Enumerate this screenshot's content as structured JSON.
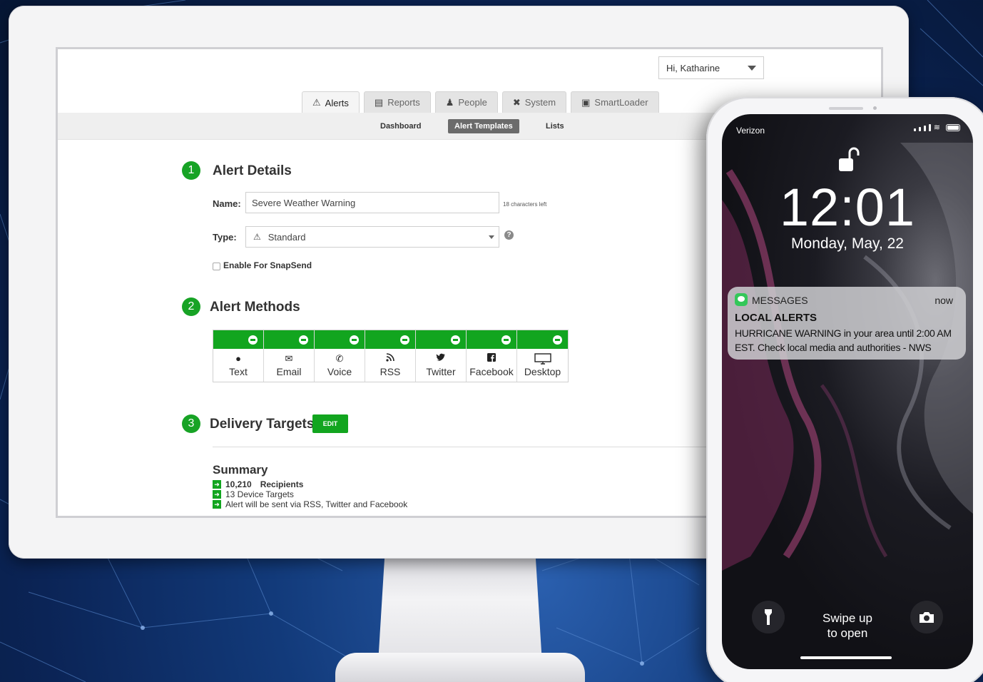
{
  "header": {
    "user_greeting": "Hi, Katharine"
  },
  "tabs": [
    {
      "label": "Alerts",
      "icon": "alert-triangle-icon",
      "active": true
    },
    {
      "label": "Reports",
      "icon": "reports-icon",
      "active": false
    },
    {
      "label": "People",
      "icon": "people-icon",
      "active": false
    },
    {
      "label": "System",
      "icon": "tools-icon",
      "active": false
    },
    {
      "label": "SmartLoader",
      "icon": "folder-upload-icon",
      "active": false
    }
  ],
  "subnav": [
    {
      "label": "Dashboard",
      "active": false
    },
    {
      "label": "Alert Templates",
      "active": true
    },
    {
      "label": "Lists",
      "active": false
    }
  ],
  "section1": {
    "number": "1",
    "title": "Alert Details",
    "name_label": "Name:",
    "name_value": "Severe Weather Warning",
    "chars_left": "18 characters left",
    "type_label": "Type:",
    "type_value": "Standard",
    "snapsend_label": "Enable For SnapSend"
  },
  "section2": {
    "number": "2",
    "title": "Alert Methods",
    "methods": [
      {
        "label": "Text",
        "icon": "speech-bubble-icon"
      },
      {
        "label": "Email",
        "icon": "envelope-icon"
      },
      {
        "label": "Voice",
        "icon": "phone-icon"
      },
      {
        "label": "RSS",
        "icon": "rss-icon"
      },
      {
        "label": "Twitter",
        "icon": "twitter-icon"
      },
      {
        "label": "Facebook",
        "icon": "facebook-icon"
      },
      {
        "label": "Desktop",
        "icon": "desktop-icon"
      }
    ]
  },
  "section3": {
    "number": "3",
    "title": "Delivery Targets",
    "edit_label": "EDIT"
  },
  "summary": {
    "title": "Summary",
    "recipients_count": "10,210",
    "recipients_label": "Recipients",
    "device_targets": "13 Device Targets",
    "channels": "Alert will be sent via RSS, Twitter and Facebook"
  },
  "phone": {
    "carrier": "Verizon",
    "time": "12:01",
    "date": "Monday, May, 22",
    "notification": {
      "app": "MESSAGES",
      "when": "now",
      "title": "LOCAL ALERTS",
      "message": "HURRICANE WARNING in your area until 2:00 AM EST. Check local media and authorities - NWS"
    },
    "swipe_line1": "Swipe up",
    "swipe_line2": "to open"
  },
  "colors": {
    "accent_green": "#12a51f",
    "step_green": "#17a325",
    "background_blue": "#0b2456"
  }
}
